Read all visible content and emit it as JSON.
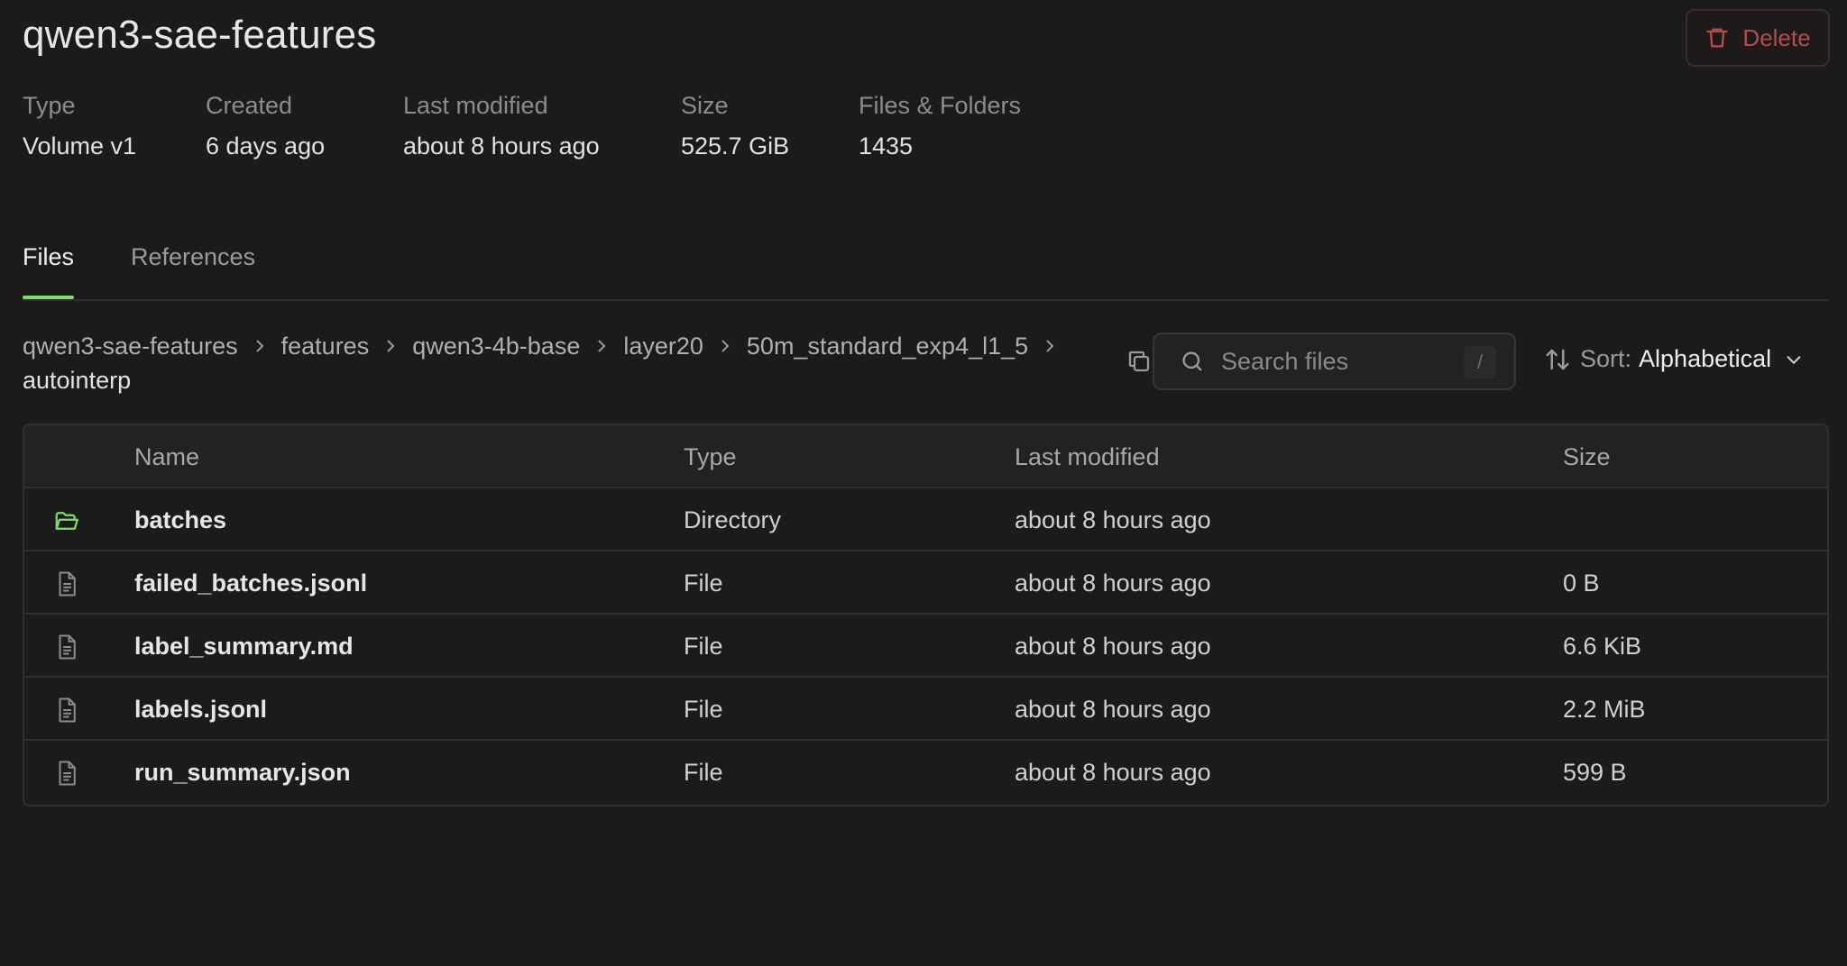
{
  "volume": {
    "title": "qwen3-sae-features",
    "delete_label": "Delete"
  },
  "meta": [
    {
      "label": "Type",
      "value": "Volume v1"
    },
    {
      "label": "Created",
      "value": "6 days ago"
    },
    {
      "label": "Last modified",
      "value": "about 8 hours ago"
    },
    {
      "label": "Size",
      "value": "525.7 GiB"
    },
    {
      "label": "Files & Folders",
      "value": "1435"
    }
  ],
  "tabs": [
    {
      "label": "Files",
      "active": true
    },
    {
      "label": "References",
      "active": false
    }
  ],
  "breadcrumb": [
    "qwen3-sae-features",
    "features",
    "qwen3-4b-base",
    "layer20",
    "50m_standard_exp4_l1_5",
    "autointerp"
  ],
  "search": {
    "placeholder": "Search files",
    "shortcut": "/"
  },
  "sort": {
    "label": "Sort:",
    "value": "Alphabetical"
  },
  "table": {
    "headers": [
      "Name",
      "Type",
      "Last modified",
      "Size"
    ],
    "rows": [
      {
        "icon": "folder-icon",
        "name": "batches",
        "type": "Directory",
        "modified": "about 8 hours ago",
        "size": ""
      },
      {
        "icon": "file-icon",
        "name": "failed_batches.jsonl",
        "type": "File",
        "modified": "about 8 hours ago",
        "size": "0 B"
      },
      {
        "icon": "file-icon",
        "name": "label_summary.md",
        "type": "File",
        "modified": "about 8 hours ago",
        "size": "6.6 KiB"
      },
      {
        "icon": "file-icon",
        "name": "labels.jsonl",
        "type": "File",
        "modified": "about 8 hours ago",
        "size": "2.2 MiB"
      },
      {
        "icon": "file-icon",
        "name": "run_summary.json",
        "type": "File",
        "modified": "about 8 hours ago",
        "size": "599 B"
      }
    ]
  },
  "colors": {
    "background": "#1b1b1b",
    "accent": "#7fdc6a",
    "danger": "#b34c4c"
  }
}
